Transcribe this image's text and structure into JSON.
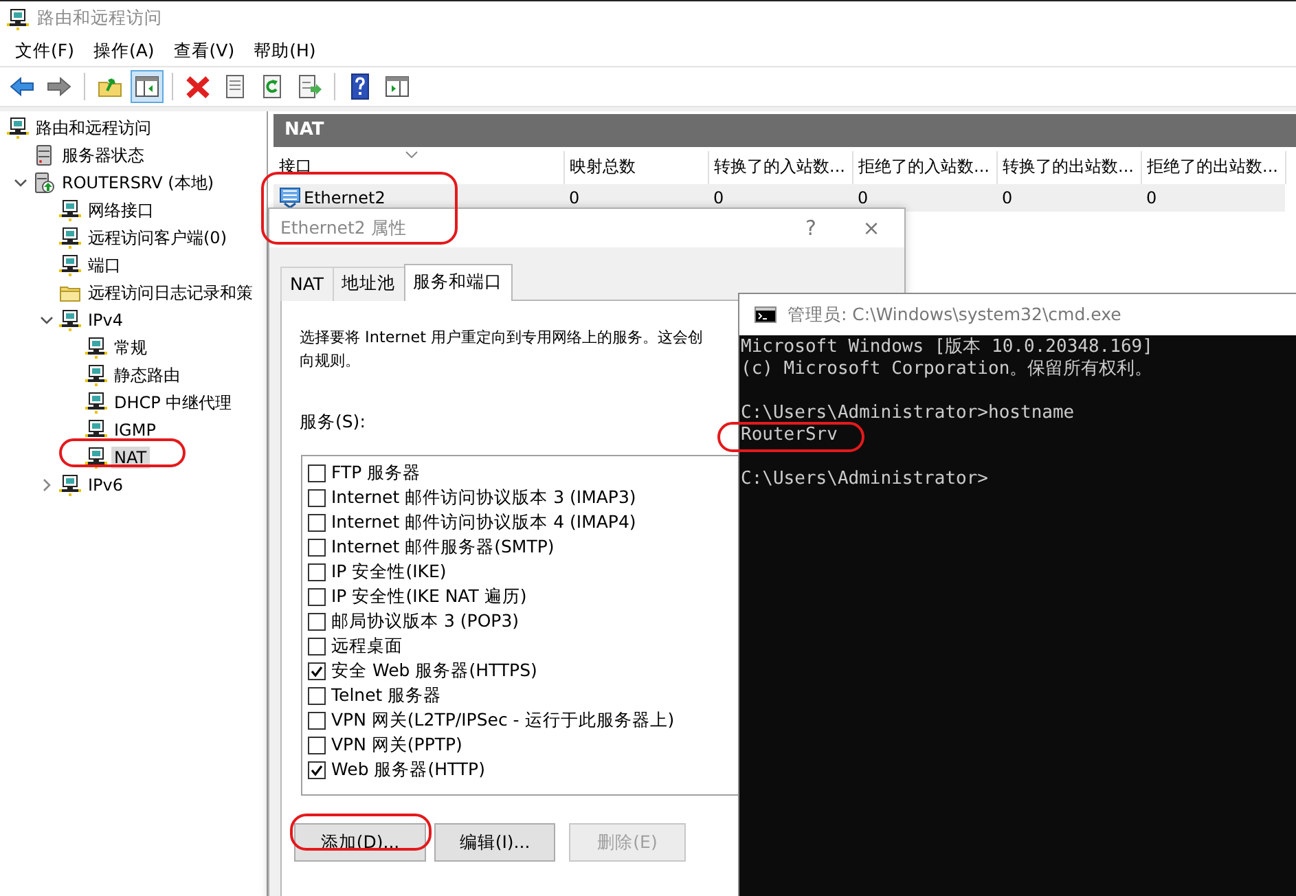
{
  "window": {
    "title": "路由和远程访问"
  },
  "menu": [
    "文件(F)",
    "操作(A)",
    "查看(V)",
    "帮助(H)"
  ],
  "toolbar": [
    [
      {
        "kind": "back",
        "pressed": false
      },
      {
        "kind": "forward",
        "pressed": false
      }
    ],
    [
      {
        "kind": "up",
        "pressed": false
      },
      {
        "kind": "tree-toggle",
        "pressed": true
      }
    ],
    [
      {
        "kind": "delete",
        "pressed": false
      },
      {
        "kind": "properties",
        "pressed": false
      },
      {
        "kind": "refresh",
        "pressed": false
      },
      {
        "kind": "export",
        "pressed": false
      }
    ],
    [
      {
        "kind": "help",
        "pressed": false
      },
      {
        "kind": "show-pane",
        "pressed": false
      }
    ]
  ],
  "tree": [
    {
      "label": "路由和远程访问",
      "kind": "node",
      "selected": false,
      "children": [
        {
          "label": "服务器状态",
          "kind": "server",
          "selected": false
        },
        {
          "label": "ROUTERSRV (本地)",
          "kind": "server-local",
          "selected": false,
          "expanded": true,
          "children": [
            {
              "label": "网络接口",
              "kind": "node",
              "selected": false
            },
            {
              "label": "远程访问客户端(0)",
              "kind": "node",
              "selected": false
            },
            {
              "label": "端口",
              "kind": "node",
              "selected": false
            },
            {
              "label": "远程访问日志记录和策",
              "kind": "folder",
              "selected": false
            },
            {
              "label": "IPv4",
              "kind": "node",
              "selected": false,
              "expanded": true,
              "children": [
                {
                  "label": "常规",
                  "kind": "node",
                  "selected": false
                },
                {
                  "label": "静态路由",
                  "kind": "node",
                  "selected": false
                },
                {
                  "label": "DHCP 中继代理",
                  "kind": "node",
                  "selected": false
                },
                {
                  "label": "IGMP",
                  "kind": "node",
                  "selected": false
                },
                {
                  "label": "NAT",
                  "kind": "node",
                  "selected": true
                }
              ]
            },
            {
              "label": "IPv6",
              "kind": "node",
              "selected": false,
              "expanded": false
            }
          ]
        }
      ]
    }
  ],
  "result_pane": {
    "title": "NAT",
    "columns": [
      "接口",
      "映射总数",
      "转换了的入站数...",
      "拒绝了的入站数...",
      "转换了的出站数...",
      "拒绝了的出站数..."
    ],
    "rows": [
      {
        "cells": [
          "Ethernet2",
          "0",
          "0",
          "0",
          "0",
          "0"
        ],
        "selected": true
      }
    ]
  },
  "dialog": {
    "title": "Ethernet2 属性",
    "help": "?",
    "close": "×",
    "tabs": [
      {
        "label": "NAT",
        "selected": false
      },
      {
        "label": "地址池",
        "selected": false
      },
      {
        "label": "服务和端口",
        "selected": true
      }
    ],
    "description": [
      "选择要将 Internet 用户重定向到专用网络上的服务。这会创",
      "向规则。"
    ],
    "services_label": "服务(S):",
    "services": [
      {
        "label": "FTP 服务器",
        "checked": false
      },
      {
        "label": "Internet 邮件访问协议版本 3 (IMAP3)",
        "checked": false
      },
      {
        "label": "Internet 邮件访问协议版本 4 (IMAP4)",
        "checked": false
      },
      {
        "label": "Internet 邮件服务器(SMTP)",
        "checked": false
      },
      {
        "label": "IP 安全性(IKE)",
        "checked": false
      },
      {
        "label": "IP 安全性(IKE NAT 遍历)",
        "checked": false
      },
      {
        "label": "邮局协议版本 3 (POP3)",
        "checked": false
      },
      {
        "label": "远程桌面",
        "checked": false
      },
      {
        "label": "安全 Web 服务器(HTTPS)",
        "checked": true
      },
      {
        "label": "Telnet 服务器",
        "checked": false
      },
      {
        "label": "VPN 网关(L2TP/IPSec - 运行于此服务器上)",
        "checked": false
      },
      {
        "label": "VPN 网关(PPTP)",
        "checked": false
      },
      {
        "label": "Web 服务器(HTTP)",
        "checked": true
      }
    ],
    "buttons": [
      {
        "label": "添加(D)...",
        "disabled": false
      },
      {
        "label": "编辑(I)...",
        "disabled": false
      },
      {
        "label": "删除(E)",
        "disabled": true
      }
    ]
  },
  "console": {
    "title": "管理员: C:\\Windows\\system32\\cmd.exe",
    "blocks": [
      [
        "Microsoft Windows [版本 10.0.20348.169]",
        "(c) Microsoft Corporation。保留所有权利。"
      ],
      [
        "C:\\Users\\Administrator>hostname",
        "RouterSrv"
      ],
      [
        "C:\\Users\\Administrator>"
      ]
    ]
  }
}
